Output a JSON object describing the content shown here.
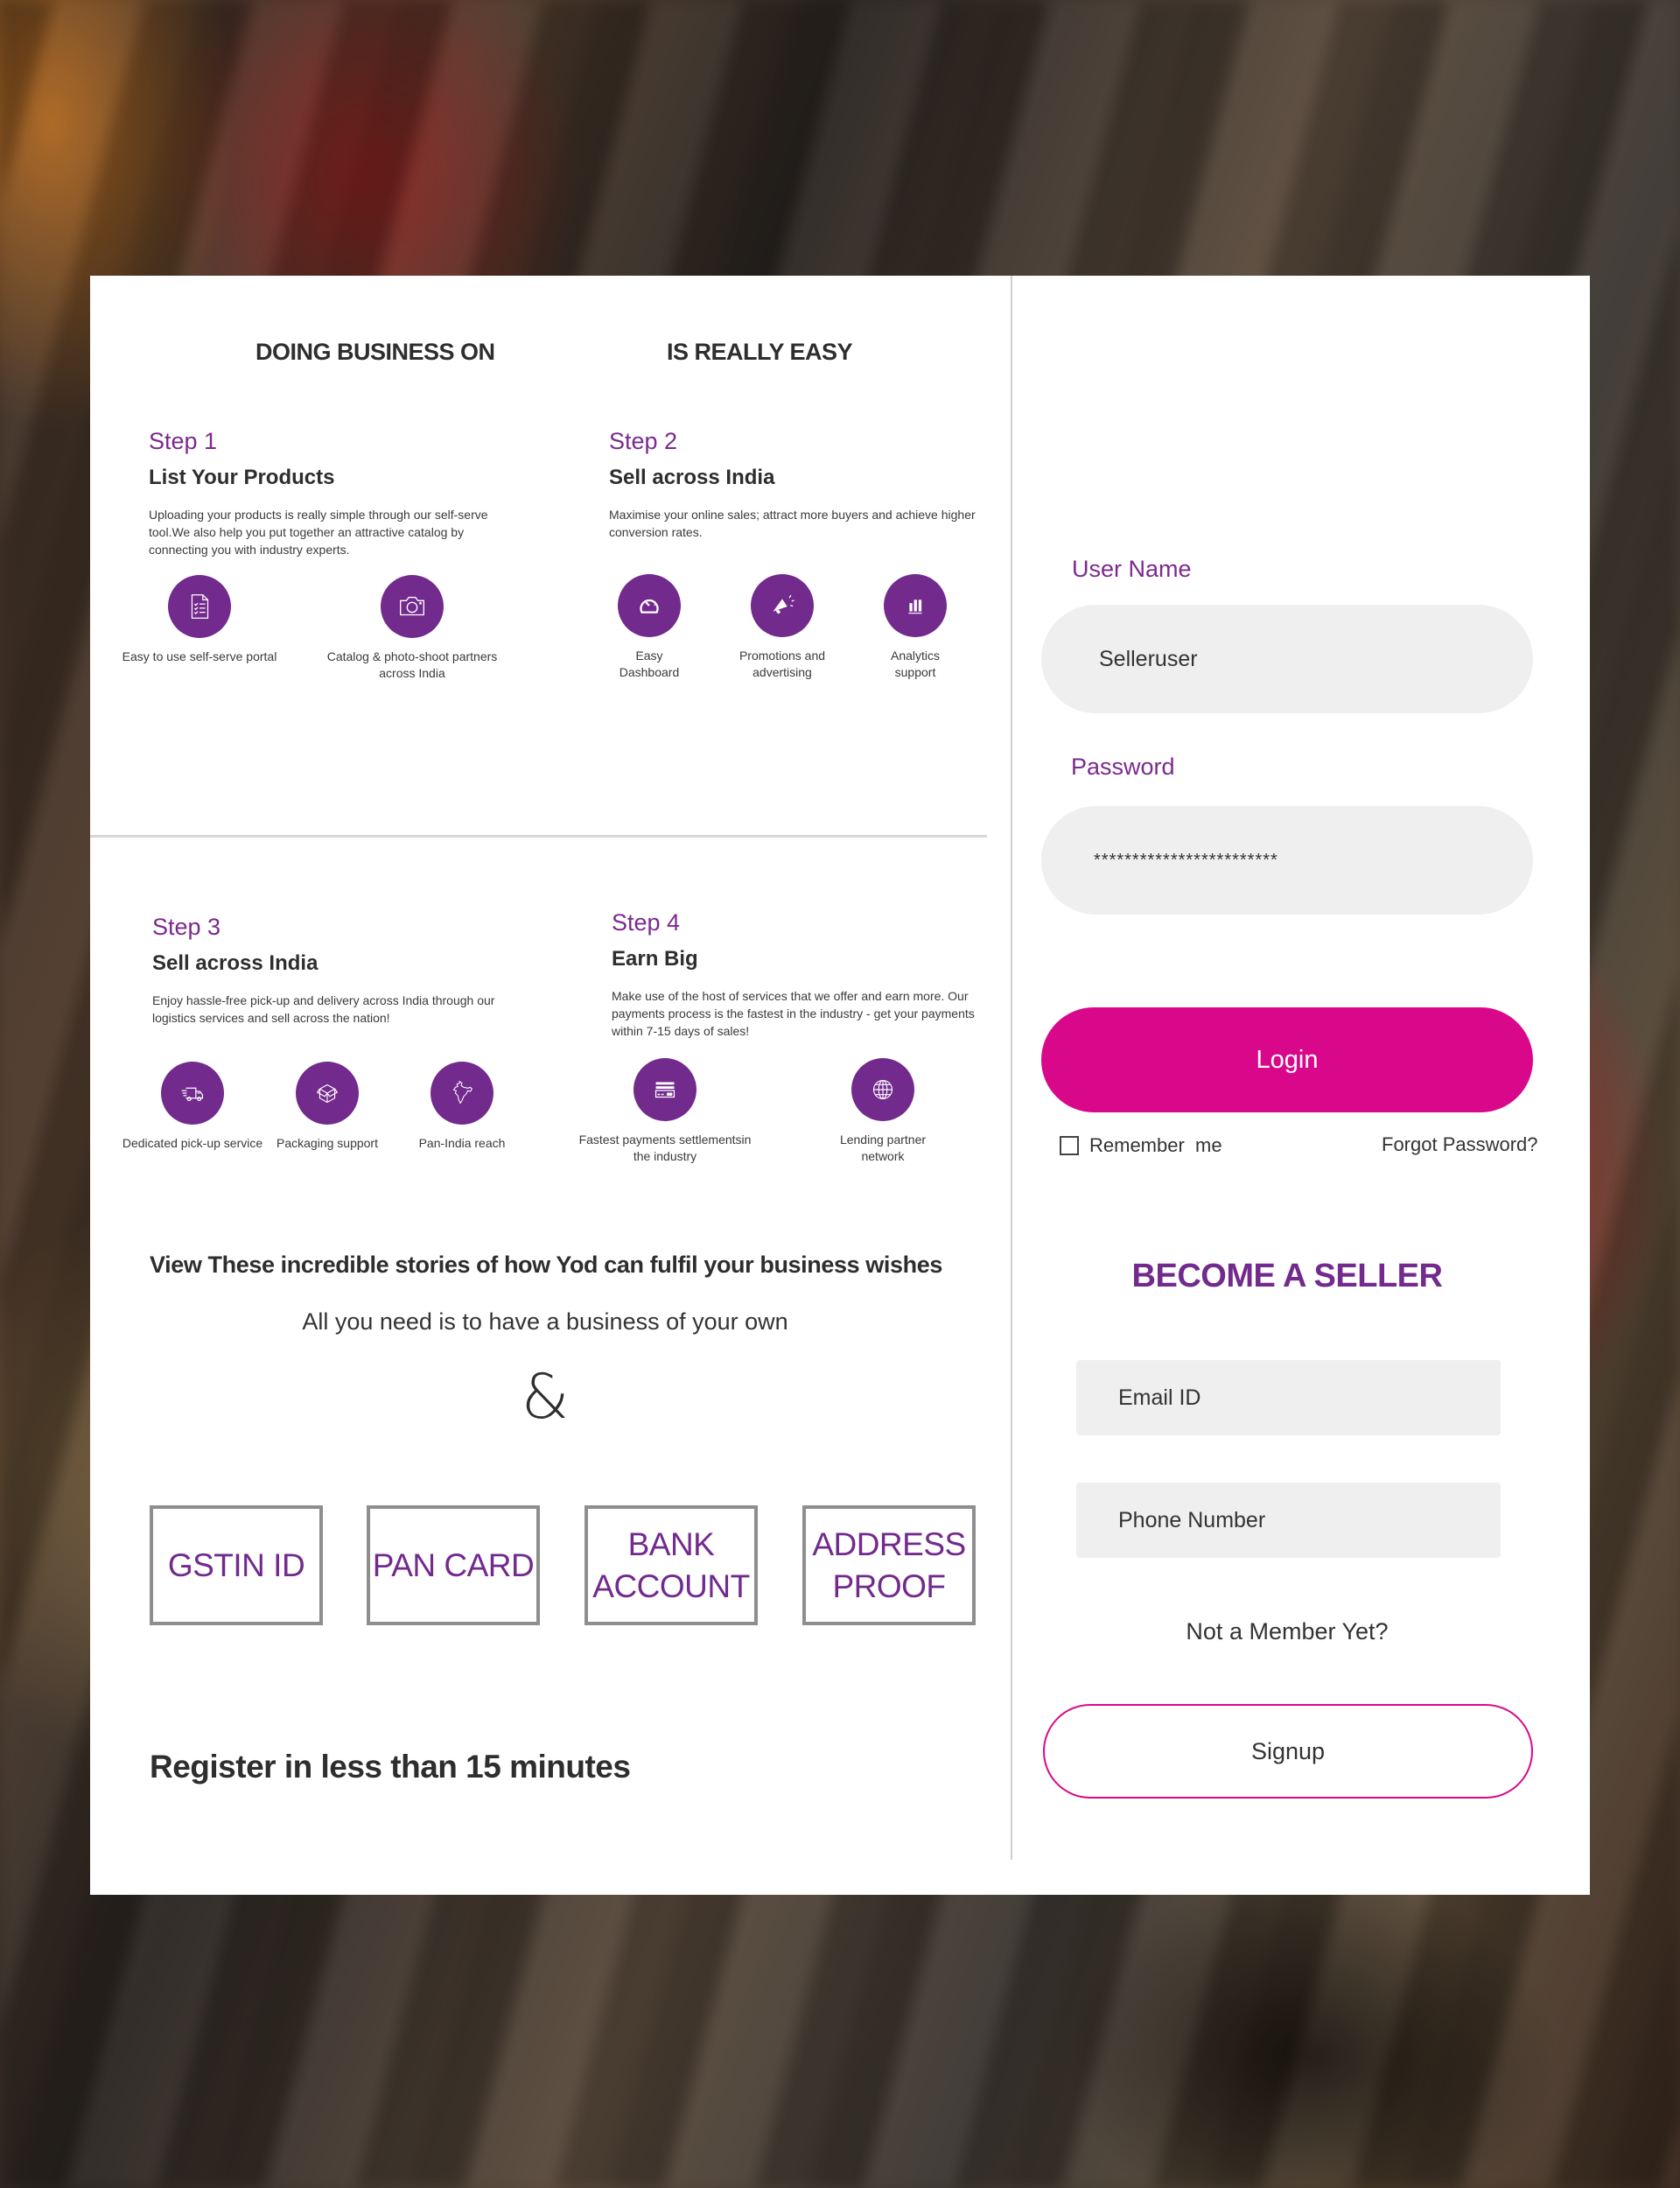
{
  "colors": {
    "brand_purple": "#722a8d",
    "accent_pink": "#d9088a",
    "input_bg": "#efefef",
    "text_dark": "#2e2e2e"
  },
  "intro": {
    "headline_left": "DOING BUSINESS ON",
    "headline_right": "IS REALLY EASY"
  },
  "steps": [
    {
      "number": "Step 1",
      "title": "List Your Products",
      "description": "Uploading your products is really simple through our self-serve tool.We also help you put together an attractive catalog by connecting you with industry experts.",
      "features": [
        {
          "icon": "checklist-document-icon",
          "label": "Easy to use self-serve portal"
        },
        {
          "icon": "camera-icon",
          "label": "Catalog & photo-shoot partners across India"
        }
      ]
    },
    {
      "number": "Step 2",
      "title": "Sell across India",
      "description": "Maximise your online sales; attract more buyers and achieve higher conversion rates.",
      "features": [
        {
          "icon": "dashboard-gauge-icon",
          "label": "Easy Dashboard"
        },
        {
          "icon": "megaphone-icon",
          "label": "Promotions and advertising"
        },
        {
          "icon": "bar-chart-icon",
          "label": "Analytics support"
        }
      ]
    },
    {
      "number": "Step 3",
      "title": "Sell across India",
      "description": "Enjoy hassle-free pick-up and delivery across India through our logistics services and sell across the nation!",
      "features": [
        {
          "icon": "delivery-truck-icon",
          "label": "Dedicated pick-up service"
        },
        {
          "icon": "package-box-icon",
          "label": "Packaging support"
        },
        {
          "icon": "india-map-icon",
          "label": "Pan-India reach"
        }
      ]
    },
    {
      "number": "Step 4",
      "title": "Earn Big",
      "description": "Make use of the host of services that we offer and earn more. Our payments process is the fastest in the industry - get your payments within 7-15 days of sales!",
      "features": [
        {
          "icon": "credit-card-icon",
          "label": "Fastest payments settlementsin the industry"
        },
        {
          "icon": "globe-icon",
          "label": "Lending partner network"
        }
      ]
    }
  ],
  "stories": {
    "heading": "View These incredible stories of how Yod can fulfil your business wishes",
    "subheading": "All you need is to have a business of your own",
    "ampersand": "&"
  },
  "documents": [
    "GSTIN ID",
    "PAN CARD",
    "BANK ACCOUNT",
    "ADDRESS PROOF"
  ],
  "register_text": "Register in less than 15 minutes",
  "login": {
    "username_label": "User Name",
    "username_value": "Selleruser",
    "password_label": "Password",
    "password_value": "************************",
    "login_button": "Login",
    "remember_me": "Remember  me",
    "remember_checked": false,
    "forgot_password": "Forgot Password?"
  },
  "signup": {
    "heading": "BECOME A SELLER",
    "email_placeholder": "Email ID",
    "phone_placeholder": "Phone Number",
    "not_member": "Not a Member Yet?",
    "signup_button": "Signup"
  }
}
